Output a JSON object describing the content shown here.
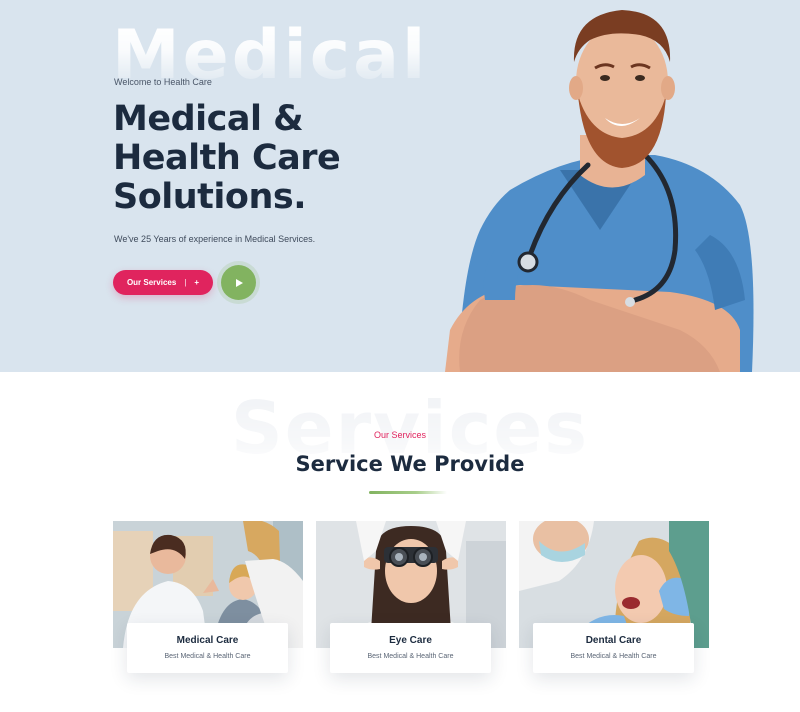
{
  "hero": {
    "watermark": "Medical",
    "eyebrow": "Welcome to Health Care",
    "title_lines": [
      "Medical &",
      "Health Care",
      "Solutions."
    ],
    "subtitle": "We've 25 Years of experience in Medical Services.",
    "cta_label": "Our Services",
    "cta_separator": "|",
    "cta_icon": "+",
    "play_icon": "play-icon"
  },
  "services": {
    "watermark": "Services",
    "eyebrow": "Our Services",
    "title": "Service We Provide",
    "cards": [
      {
        "title": "Medical Care",
        "subtitle": "Best Medical & Health Care"
      },
      {
        "title": "Eye Care",
        "subtitle": "Best Medical & Health Care"
      },
      {
        "title": "Dental Care",
        "subtitle": "Best Medical & Health Care"
      }
    ]
  },
  "colors": {
    "hero_bg": "#d9e4ee",
    "primary_text": "#1c2b3f",
    "accent_pink": "#e0245e",
    "accent_green": "#82b360"
  }
}
